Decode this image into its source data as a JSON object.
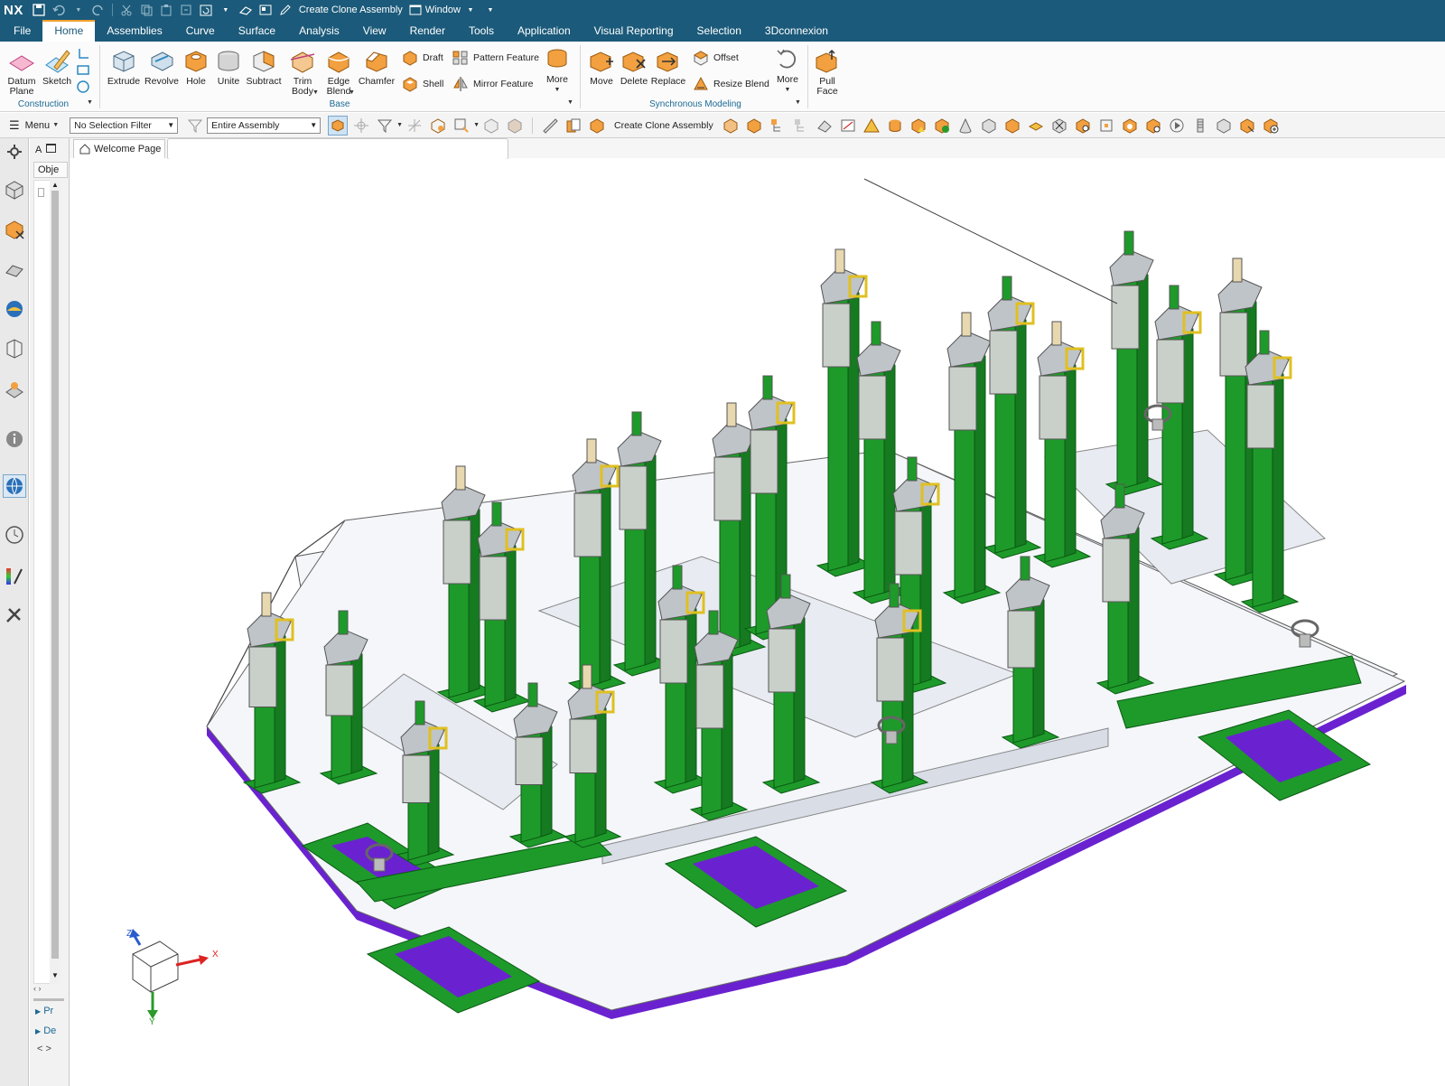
{
  "app": {
    "logo": "NX"
  },
  "quick_access": {
    "clone_label": "Create Clone Assembly",
    "window_label": "Window"
  },
  "menu": {
    "tabs": [
      "File",
      "Home",
      "Assemblies",
      "Curve",
      "Surface",
      "Analysis",
      "View",
      "Render",
      "Tools",
      "Application",
      "Visual Reporting",
      "Selection",
      "3Dconnexion"
    ],
    "active": "Home"
  },
  "ribbon": {
    "construction": {
      "datum_plane": "Datum Plane",
      "sketch": "Sketch",
      "label": "Construction"
    },
    "base": {
      "extrude": "Extrude",
      "revolve": "Revolve",
      "hole": "Hole",
      "unite": "Unite",
      "subtract": "Subtract",
      "trim_body": "Trim Body",
      "edge_blend": "Edge Blend",
      "chamfer": "Chamfer",
      "draft": "Draft",
      "shell": "Shell",
      "pattern_feature": "Pattern Feature",
      "mirror_feature": "Mirror Feature",
      "more": "More",
      "label": "Base"
    },
    "sync": {
      "move": "Move",
      "delete": "Delete",
      "replace": "Replace",
      "offset": "Offset",
      "resize_blend": "Resize Blend",
      "more": "More",
      "label": "Synchronous Modeling"
    },
    "pull_face": "Pull Face"
  },
  "selection_bar": {
    "menu_label": "Menu",
    "filter": "No Selection Filter",
    "scope": "Entire Assembly",
    "clone_label": "Create Clone Assembly"
  },
  "nav_panel": {
    "header_short": "A",
    "column_short": "Obje",
    "section1": "Pr",
    "section2": "De"
  },
  "tabs": {
    "welcome": "Welcome Page"
  },
  "triad": {
    "x": "X",
    "y": "Y",
    "z": "Z"
  },
  "colors": {
    "frame": "#1b5a7a",
    "accent": "#f0a030",
    "green": "#1e9a2a",
    "purple": "#6a22d0",
    "plate": "#f4f6fa"
  }
}
